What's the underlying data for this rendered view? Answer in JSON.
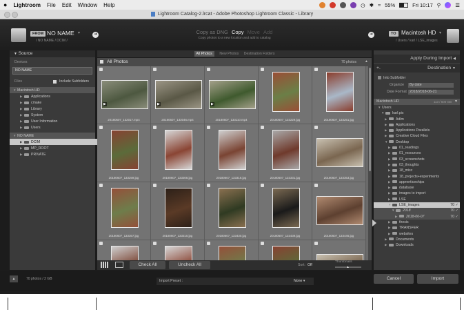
{
  "menubar": {
    "apple": "",
    "items": [
      "Lightroom",
      "File",
      "Edit",
      "Window",
      "Help"
    ],
    "battery": "55%",
    "clock": "Fri 10:17"
  },
  "window": {
    "title": "Lightroom Catalog-2.lrcat - Adobe Photoshop Lightroom Classic - Library"
  },
  "source_header": {
    "from_label": "FROM",
    "source_name": "NO NAME",
    "source_path": "/ NO NAME / DCIM /"
  },
  "mode": {
    "options": [
      "Copy as DNG",
      "Copy",
      "Move",
      "Add"
    ],
    "selected": "Copy",
    "description": "Copy photos to a new location and add to catalog"
  },
  "dest_header": {
    "to_label": "TO",
    "dest_name": "Macintosh HD",
    "dest_path": "/ Users / karl / LSE_images"
  },
  "source_panel": {
    "title": "Source",
    "devices_label": "Devices",
    "device": "NO NAME",
    "files_label": "Files",
    "include_subfolders": "Include Subfolders",
    "volume1": "Macintosh HD",
    "vol1_folders": [
      "Applications",
      "cmake",
      "Library",
      "System",
      "User Information",
      "Users"
    ],
    "volume2": "NO NAME",
    "vol2_folders": [
      "DCIM",
      "MP_ROOT",
      "PRIVATE"
    ]
  },
  "filter_tabs": [
    "All Photos",
    "New Photos",
    "Destination Folders"
  ],
  "grid": {
    "header": "All Photos",
    "count": "70 photos",
    "photos": [
      {
        "name": "20180607_132017.mp4",
        "kind": "landscape",
        "video": true,
        "c1": "#4d5840",
        "c2": "#8a8d7a"
      },
      {
        "name": "20180607_133046.mp4",
        "kind": "landscape",
        "video": true,
        "c1": "#5a5846",
        "c2": "#9b9585"
      },
      {
        "name": "20180607_133110.mp4",
        "kind": "landscape",
        "video": true,
        "c1": "#3f5a2e",
        "c2": "#a4a08a"
      },
      {
        "name": "20180607_133229.jpg",
        "kind": "portrait",
        "video": false,
        "c1": "#6b7f47",
        "c2": "#9a4e36"
      },
      {
        "name": "20180607_133251.jpg",
        "kind": "portrait",
        "video": false,
        "c1": "#a9b8c8",
        "c2": "#8a3d2c"
      },
      {
        "name": "20180607_133259.jpg",
        "kind": "portrait",
        "video": false,
        "c1": "#5b6b3a",
        "c2": "#874232"
      },
      {
        "name": "20180607_133308.jpg",
        "kind": "portrait",
        "video": false,
        "c1": "#8a4534",
        "c2": "#d6d6d6"
      },
      {
        "name": "20180607_133318.jpg",
        "kind": "portrait",
        "video": false,
        "c1": "#7a4433",
        "c2": "#cfcfcf"
      },
      {
        "name": "20180607_133331.jpg",
        "kind": "portrait",
        "video": false,
        "c1": "#6f3a2c",
        "c2": "#a9a9a9"
      },
      {
        "name": "20180607_133353.jpg",
        "kind": "landscape",
        "video": false,
        "c1": "#7a6650",
        "c2": "#c8c0b0"
      },
      {
        "name": "20180607_133357.jpg",
        "kind": "portrait",
        "video": false,
        "c1": "#6e7d4b",
        "c2": "#94503a"
      },
      {
        "name": "20180607_133310.jpg",
        "kind": "portrait",
        "video": false,
        "c1": "#5a3a26",
        "c2": "#2c2018"
      },
      {
        "name": "20180607_133430.jpg",
        "kind": "portrait",
        "video": false,
        "c1": "#2f3a22",
        "c2": "#8a7050"
      },
      {
        "name": "20180607_133439.jpg",
        "kind": "portrait",
        "video": false,
        "c1": "#1a1a1a",
        "c2": "#7b6a52"
      },
      {
        "name": "20180607_133446.jpg",
        "kind": "landscape",
        "video": false,
        "c1": "#5d4030",
        "c2": "#b08a70"
      },
      {
        "name": "",
        "kind": "portrait",
        "video": false,
        "c1": "#7a4433",
        "c2": "#cfcfcf"
      },
      {
        "name": "",
        "kind": "portrait",
        "video": false,
        "c1": "#8a4534",
        "c2": "#d6d6d6"
      },
      {
        "name": "",
        "kind": "portrait",
        "video": false,
        "c1": "#6e7d4b",
        "c2": "#94503a"
      },
      {
        "name": "",
        "kind": "portrait",
        "video": false,
        "c1": "#5b6b3a",
        "c2": "#874232"
      },
      {
        "name": "",
        "kind": "landscape",
        "video": false,
        "c1": "#7a6650",
        "c2": "#c8c0b0"
      }
    ]
  },
  "grid_toolbar": {
    "check_all": "Check All",
    "uncheck_all": "Uncheck All",
    "sort_label": "Sort:",
    "sort_value": "Off",
    "thumbnails_label": "Thumbnails"
  },
  "right_panel": {
    "apply_during_import": "Apply During Import",
    "destination": "Destination",
    "into_subfolder": "Into Subfolder",
    "organize_label": "Organize",
    "organize_value": "By date",
    "date_format_label": "Date Format",
    "date_format_value": "2018/2018-06-21",
    "volume": "Macintosh HD",
    "volume_info": "113 / 500 GB",
    "folders": [
      {
        "label": "Users",
        "depth": 0,
        "open": true
      },
      {
        "label": "karl.pix",
        "depth": 1,
        "open": true
      },
      {
        "label": "Adlm",
        "depth": 2,
        "open": false
      },
      {
        "label": "Applications",
        "depth": 2,
        "open": false
      },
      {
        "label": "Applications Parallels",
        "depth": 2,
        "open": false
      },
      {
        "label": "Creative Cloud Files",
        "depth": 2,
        "open": false
      },
      {
        "label": "Desktop",
        "depth": 2,
        "open": true
      },
      {
        "label": "01_readings",
        "depth": 3,
        "open": false
      },
      {
        "label": "01_resources",
        "depth": 3,
        "open": false
      },
      {
        "label": "03_screenshots",
        "depth": 3,
        "open": false
      },
      {
        "label": "03_thoughts",
        "depth": 3,
        "open": false
      },
      {
        "label": "18_misc",
        "depth": 3,
        "open": false
      },
      {
        "label": "18_projects+experiments",
        "depth": 3,
        "open": false
      },
      {
        "label": "apprenticeships",
        "depth": 3,
        "open": false
      },
      {
        "label": "database",
        "depth": 3,
        "open": false
      },
      {
        "label": "images to import",
        "depth": 3,
        "open": false
      },
      {
        "label": "LSE",
        "depth": 3,
        "open": false
      },
      {
        "label": "LSE_images",
        "depth": 3,
        "open": true,
        "selected": true,
        "count": "70"
      },
      {
        "label": "2018",
        "depth": 4,
        "open": true,
        "italic": true,
        "count": "70"
      },
      {
        "label": "2018-06-07",
        "depth": 5,
        "open": false,
        "italic": true,
        "count": "70"
      },
      {
        "label": "thesis",
        "depth": 3,
        "open": false
      },
      {
        "label": "TRANSFER",
        "depth": 3,
        "open": false
      },
      {
        "label": "websites",
        "depth": 3,
        "open": false
      },
      {
        "label": "Documents",
        "depth": 2,
        "open": false
      },
      {
        "label": "Downloads",
        "depth": 2,
        "open": false
      }
    ]
  },
  "bottom_bar": {
    "summary": "70 photos / 2 GB",
    "import_preset_label": "Import Preset :",
    "import_preset_value": "None",
    "cancel": "Cancel",
    "import": "Import"
  },
  "colors": {
    "panel_bg": "#3a3a3a",
    "grid_bg": "#6a6a6a",
    "selected_row": "#c8c8c8",
    "accent_white": "#eeeeee"
  }
}
